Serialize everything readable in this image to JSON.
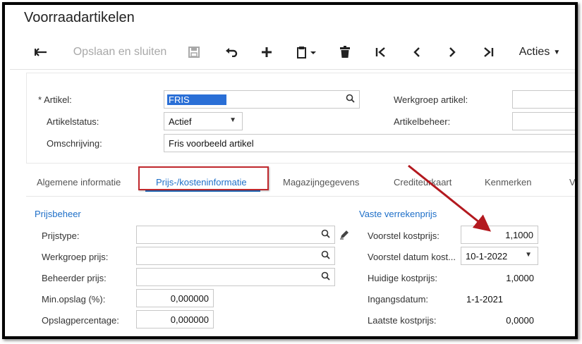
{
  "page_title": "Voorraadartikelen",
  "toolbar": {
    "back_icon": "back-arrow-icon",
    "save_close_label": "Opslaan en sluiten",
    "save_icon": "floppy-disk-icon",
    "undo_icon": "undo-icon",
    "add_icon": "plus-icon",
    "clipboard_icon": "clipboard-icon",
    "delete_icon": "trash-icon",
    "first_icon": "first-record-icon",
    "prev_icon": "previous-record-icon",
    "next_icon": "next-record-icon",
    "last_icon": "last-record-icon",
    "actions_label": "Acties"
  },
  "header": {
    "artikel_label": "Artikel:",
    "artikel_required": "*",
    "artikel_value": "FRIS",
    "artikelstatus_label": "Artikelstatus:",
    "artikelstatus_value": "Actief",
    "omschrijving_label": "Omschrijving:",
    "omschrijving_value": "Fris voorbeeld artikel",
    "werkgroep_label": "Werkgroep artikel:",
    "werkgroep_value": "",
    "artikelbeheer_label": "Artikelbeheer:",
    "artikelbeheer_value": ""
  },
  "tabs": [
    {
      "label": "Algemene informatie"
    },
    {
      "label": "Prijs-/kosteninformatie",
      "active": true
    },
    {
      "label": "Magazijngegevens"
    },
    {
      "label": "Crediteurkaart"
    },
    {
      "label": "Kenmerken"
    },
    {
      "label": "V"
    }
  ],
  "prijsbeheer": {
    "title": "Prijsbeheer",
    "prijstype_label": "Prijstype:",
    "prijstype_value": "",
    "werkgroep_prijs_label": "Werkgroep prijs:",
    "werkgroep_prijs_value": "",
    "beheerder_prijs_label": "Beheerder prijs:",
    "beheerder_prijs_value": "",
    "min_opslag_label": "Min.opslag (%):",
    "min_opslag_value": "0,000000",
    "opslagpercentage_label": "Opslagpercentage:",
    "opslagpercentage_value": "0,000000"
  },
  "vaste_verrekenprijs": {
    "title": "Vaste verrekenprijs",
    "voorstel_kostprijs_label": "Voorstel kostprijs:",
    "voorstel_kostprijs_value": "1,1000",
    "voorstel_datum_label": "Voorstel datum kost...",
    "voorstel_datum_value": "10-1-2022",
    "huidige_kostprijs_label": "Huidige kostprijs:",
    "huidige_kostprijs_value": "1,0000",
    "ingangsdatum_label": "Ingangsdatum:",
    "ingangsdatum_value": "1-1-2021",
    "laatste_kostprijs_label": "Laatste kostprijs:",
    "laatste_kostprijs_value": "0,0000"
  },
  "colors": {
    "accent": "#1e6fc8",
    "annotation_red": "#c0282d",
    "selection": "#2a6fd6"
  }
}
